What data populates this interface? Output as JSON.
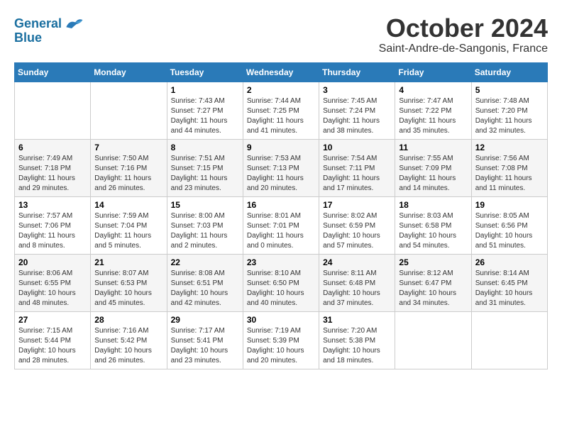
{
  "header": {
    "logo_line1": "General",
    "logo_line2": "Blue",
    "month_title": "October 2024",
    "location": "Saint-Andre-de-Sangonis, France"
  },
  "weekdays": [
    "Sunday",
    "Monday",
    "Tuesday",
    "Wednesday",
    "Thursday",
    "Friday",
    "Saturday"
  ],
  "weeks": [
    [
      {
        "day": "",
        "sunrise": "",
        "sunset": "",
        "daylight": ""
      },
      {
        "day": "",
        "sunrise": "",
        "sunset": "",
        "daylight": ""
      },
      {
        "day": "1",
        "sunrise": "Sunrise: 7:43 AM",
        "sunset": "Sunset: 7:27 PM",
        "daylight": "Daylight: 11 hours and 44 minutes."
      },
      {
        "day": "2",
        "sunrise": "Sunrise: 7:44 AM",
        "sunset": "Sunset: 7:25 PM",
        "daylight": "Daylight: 11 hours and 41 minutes."
      },
      {
        "day": "3",
        "sunrise": "Sunrise: 7:45 AM",
        "sunset": "Sunset: 7:24 PM",
        "daylight": "Daylight: 11 hours and 38 minutes."
      },
      {
        "day": "4",
        "sunrise": "Sunrise: 7:47 AM",
        "sunset": "Sunset: 7:22 PM",
        "daylight": "Daylight: 11 hours and 35 minutes."
      },
      {
        "day": "5",
        "sunrise": "Sunrise: 7:48 AM",
        "sunset": "Sunset: 7:20 PM",
        "daylight": "Daylight: 11 hours and 32 minutes."
      }
    ],
    [
      {
        "day": "6",
        "sunrise": "Sunrise: 7:49 AM",
        "sunset": "Sunset: 7:18 PM",
        "daylight": "Daylight: 11 hours and 29 minutes."
      },
      {
        "day": "7",
        "sunrise": "Sunrise: 7:50 AM",
        "sunset": "Sunset: 7:16 PM",
        "daylight": "Daylight: 11 hours and 26 minutes."
      },
      {
        "day": "8",
        "sunrise": "Sunrise: 7:51 AM",
        "sunset": "Sunset: 7:15 PM",
        "daylight": "Daylight: 11 hours and 23 minutes."
      },
      {
        "day": "9",
        "sunrise": "Sunrise: 7:53 AM",
        "sunset": "Sunset: 7:13 PM",
        "daylight": "Daylight: 11 hours and 20 minutes."
      },
      {
        "day": "10",
        "sunrise": "Sunrise: 7:54 AM",
        "sunset": "Sunset: 7:11 PM",
        "daylight": "Daylight: 11 hours and 17 minutes."
      },
      {
        "day": "11",
        "sunrise": "Sunrise: 7:55 AM",
        "sunset": "Sunset: 7:09 PM",
        "daylight": "Daylight: 11 hours and 14 minutes."
      },
      {
        "day": "12",
        "sunrise": "Sunrise: 7:56 AM",
        "sunset": "Sunset: 7:08 PM",
        "daylight": "Daylight: 11 hours and 11 minutes."
      }
    ],
    [
      {
        "day": "13",
        "sunrise": "Sunrise: 7:57 AM",
        "sunset": "Sunset: 7:06 PM",
        "daylight": "Daylight: 11 hours and 8 minutes."
      },
      {
        "day": "14",
        "sunrise": "Sunrise: 7:59 AM",
        "sunset": "Sunset: 7:04 PM",
        "daylight": "Daylight: 11 hours and 5 minutes."
      },
      {
        "day": "15",
        "sunrise": "Sunrise: 8:00 AM",
        "sunset": "Sunset: 7:03 PM",
        "daylight": "Daylight: 11 hours and 2 minutes."
      },
      {
        "day": "16",
        "sunrise": "Sunrise: 8:01 AM",
        "sunset": "Sunset: 7:01 PM",
        "daylight": "Daylight: 11 hours and 0 minutes."
      },
      {
        "day": "17",
        "sunrise": "Sunrise: 8:02 AM",
        "sunset": "Sunset: 6:59 PM",
        "daylight": "Daylight: 10 hours and 57 minutes."
      },
      {
        "day": "18",
        "sunrise": "Sunrise: 8:03 AM",
        "sunset": "Sunset: 6:58 PM",
        "daylight": "Daylight: 10 hours and 54 minutes."
      },
      {
        "day": "19",
        "sunrise": "Sunrise: 8:05 AM",
        "sunset": "Sunset: 6:56 PM",
        "daylight": "Daylight: 10 hours and 51 minutes."
      }
    ],
    [
      {
        "day": "20",
        "sunrise": "Sunrise: 8:06 AM",
        "sunset": "Sunset: 6:55 PM",
        "daylight": "Daylight: 10 hours and 48 minutes."
      },
      {
        "day": "21",
        "sunrise": "Sunrise: 8:07 AM",
        "sunset": "Sunset: 6:53 PM",
        "daylight": "Daylight: 10 hours and 45 minutes."
      },
      {
        "day": "22",
        "sunrise": "Sunrise: 8:08 AM",
        "sunset": "Sunset: 6:51 PM",
        "daylight": "Daylight: 10 hours and 42 minutes."
      },
      {
        "day": "23",
        "sunrise": "Sunrise: 8:10 AM",
        "sunset": "Sunset: 6:50 PM",
        "daylight": "Daylight: 10 hours and 40 minutes."
      },
      {
        "day": "24",
        "sunrise": "Sunrise: 8:11 AM",
        "sunset": "Sunset: 6:48 PM",
        "daylight": "Daylight: 10 hours and 37 minutes."
      },
      {
        "day": "25",
        "sunrise": "Sunrise: 8:12 AM",
        "sunset": "Sunset: 6:47 PM",
        "daylight": "Daylight: 10 hours and 34 minutes."
      },
      {
        "day": "26",
        "sunrise": "Sunrise: 8:14 AM",
        "sunset": "Sunset: 6:45 PM",
        "daylight": "Daylight: 10 hours and 31 minutes."
      }
    ],
    [
      {
        "day": "27",
        "sunrise": "Sunrise: 7:15 AM",
        "sunset": "Sunset: 5:44 PM",
        "daylight": "Daylight: 10 hours and 28 minutes."
      },
      {
        "day": "28",
        "sunrise": "Sunrise: 7:16 AM",
        "sunset": "Sunset: 5:42 PM",
        "daylight": "Daylight: 10 hours and 26 minutes."
      },
      {
        "day": "29",
        "sunrise": "Sunrise: 7:17 AM",
        "sunset": "Sunset: 5:41 PM",
        "daylight": "Daylight: 10 hours and 23 minutes."
      },
      {
        "day": "30",
        "sunrise": "Sunrise: 7:19 AM",
        "sunset": "Sunset: 5:39 PM",
        "daylight": "Daylight: 10 hours and 20 minutes."
      },
      {
        "day": "31",
        "sunrise": "Sunrise: 7:20 AM",
        "sunset": "Sunset: 5:38 PM",
        "daylight": "Daylight: 10 hours and 18 minutes."
      },
      {
        "day": "",
        "sunrise": "",
        "sunset": "",
        "daylight": ""
      },
      {
        "day": "",
        "sunrise": "",
        "sunset": "",
        "daylight": ""
      }
    ]
  ]
}
